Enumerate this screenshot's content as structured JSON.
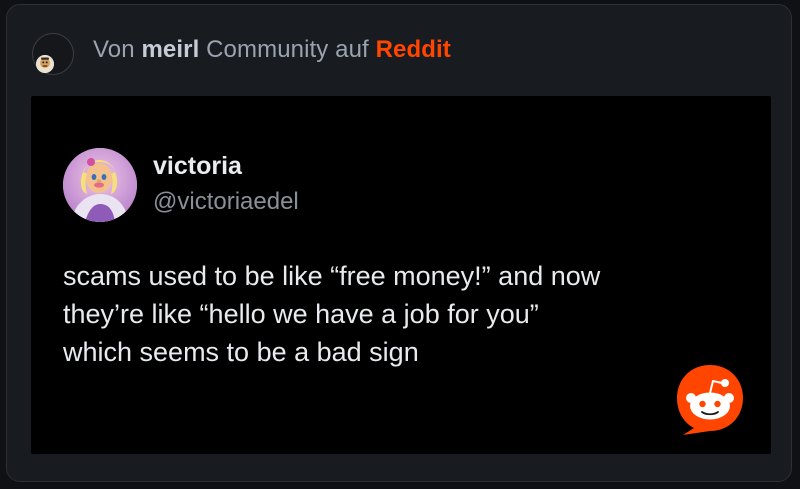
{
  "header": {
    "prefix": "Von",
    "community": "meirl",
    "middle": "Community auf",
    "platform": "Reddit",
    "icons": {
      "community_avatar": "meirl-community-avatar-icon"
    }
  },
  "tweet": {
    "display_name": "victoria",
    "handle": "@victoriaedel",
    "lines": [
      "scams used to be like “free money!” and now",
      "they’re like “hello we have a job for you”",
      "which seems to be a bad sign"
    ],
    "icons": {
      "avatar": "profile-avatar-icon",
      "watermark": "reddit-snoo-icon"
    }
  },
  "colors": {
    "page_bg": "#0f1114",
    "card_bg": "#181b20",
    "brand": "#ff4500",
    "media_bg": "#000000",
    "muted_text": "#9aa3b0"
  }
}
